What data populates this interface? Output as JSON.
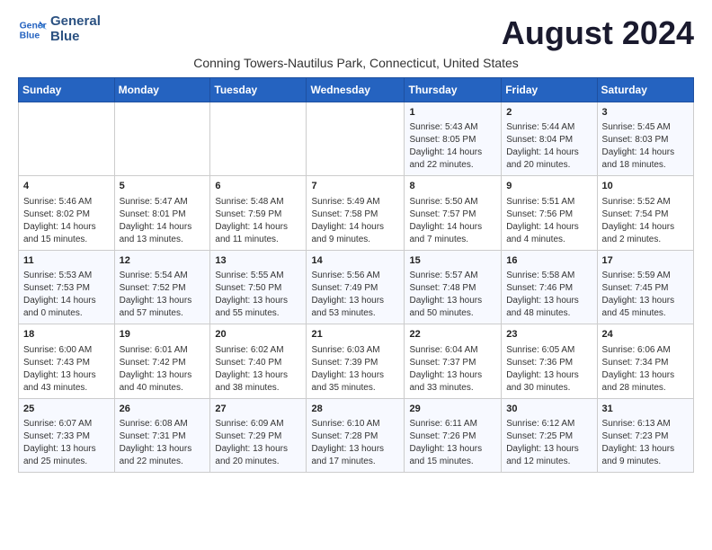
{
  "header": {
    "logo_line1": "General",
    "logo_line2": "Blue",
    "month_title": "August 2024",
    "subtitle": "Conning Towers-Nautilus Park, Connecticut, United States"
  },
  "weekdays": [
    "Sunday",
    "Monday",
    "Tuesday",
    "Wednesday",
    "Thursday",
    "Friday",
    "Saturday"
  ],
  "weeks": [
    [
      {
        "day": "",
        "info": ""
      },
      {
        "day": "",
        "info": ""
      },
      {
        "day": "",
        "info": ""
      },
      {
        "day": "",
        "info": ""
      },
      {
        "day": "1",
        "info": "Sunrise: 5:43 AM\nSunset: 8:05 PM\nDaylight: 14 hours and 22 minutes."
      },
      {
        "day": "2",
        "info": "Sunrise: 5:44 AM\nSunset: 8:04 PM\nDaylight: 14 hours and 20 minutes."
      },
      {
        "day": "3",
        "info": "Sunrise: 5:45 AM\nSunset: 8:03 PM\nDaylight: 14 hours and 18 minutes."
      }
    ],
    [
      {
        "day": "4",
        "info": "Sunrise: 5:46 AM\nSunset: 8:02 PM\nDaylight: 14 hours and 15 minutes."
      },
      {
        "day": "5",
        "info": "Sunrise: 5:47 AM\nSunset: 8:01 PM\nDaylight: 14 hours and 13 minutes."
      },
      {
        "day": "6",
        "info": "Sunrise: 5:48 AM\nSunset: 7:59 PM\nDaylight: 14 hours and 11 minutes."
      },
      {
        "day": "7",
        "info": "Sunrise: 5:49 AM\nSunset: 7:58 PM\nDaylight: 14 hours and 9 minutes."
      },
      {
        "day": "8",
        "info": "Sunrise: 5:50 AM\nSunset: 7:57 PM\nDaylight: 14 hours and 7 minutes."
      },
      {
        "day": "9",
        "info": "Sunrise: 5:51 AM\nSunset: 7:56 PM\nDaylight: 14 hours and 4 minutes."
      },
      {
        "day": "10",
        "info": "Sunrise: 5:52 AM\nSunset: 7:54 PM\nDaylight: 14 hours and 2 minutes."
      }
    ],
    [
      {
        "day": "11",
        "info": "Sunrise: 5:53 AM\nSunset: 7:53 PM\nDaylight: 14 hours and 0 minutes."
      },
      {
        "day": "12",
        "info": "Sunrise: 5:54 AM\nSunset: 7:52 PM\nDaylight: 13 hours and 57 minutes."
      },
      {
        "day": "13",
        "info": "Sunrise: 5:55 AM\nSunset: 7:50 PM\nDaylight: 13 hours and 55 minutes."
      },
      {
        "day": "14",
        "info": "Sunrise: 5:56 AM\nSunset: 7:49 PM\nDaylight: 13 hours and 53 minutes."
      },
      {
        "day": "15",
        "info": "Sunrise: 5:57 AM\nSunset: 7:48 PM\nDaylight: 13 hours and 50 minutes."
      },
      {
        "day": "16",
        "info": "Sunrise: 5:58 AM\nSunset: 7:46 PM\nDaylight: 13 hours and 48 minutes."
      },
      {
        "day": "17",
        "info": "Sunrise: 5:59 AM\nSunset: 7:45 PM\nDaylight: 13 hours and 45 minutes."
      }
    ],
    [
      {
        "day": "18",
        "info": "Sunrise: 6:00 AM\nSunset: 7:43 PM\nDaylight: 13 hours and 43 minutes."
      },
      {
        "day": "19",
        "info": "Sunrise: 6:01 AM\nSunset: 7:42 PM\nDaylight: 13 hours and 40 minutes."
      },
      {
        "day": "20",
        "info": "Sunrise: 6:02 AM\nSunset: 7:40 PM\nDaylight: 13 hours and 38 minutes."
      },
      {
        "day": "21",
        "info": "Sunrise: 6:03 AM\nSunset: 7:39 PM\nDaylight: 13 hours and 35 minutes."
      },
      {
        "day": "22",
        "info": "Sunrise: 6:04 AM\nSunset: 7:37 PM\nDaylight: 13 hours and 33 minutes."
      },
      {
        "day": "23",
        "info": "Sunrise: 6:05 AM\nSunset: 7:36 PM\nDaylight: 13 hours and 30 minutes."
      },
      {
        "day": "24",
        "info": "Sunrise: 6:06 AM\nSunset: 7:34 PM\nDaylight: 13 hours and 28 minutes."
      }
    ],
    [
      {
        "day": "25",
        "info": "Sunrise: 6:07 AM\nSunset: 7:33 PM\nDaylight: 13 hours and 25 minutes."
      },
      {
        "day": "26",
        "info": "Sunrise: 6:08 AM\nSunset: 7:31 PM\nDaylight: 13 hours and 22 minutes."
      },
      {
        "day": "27",
        "info": "Sunrise: 6:09 AM\nSunset: 7:29 PM\nDaylight: 13 hours and 20 minutes."
      },
      {
        "day": "28",
        "info": "Sunrise: 6:10 AM\nSunset: 7:28 PM\nDaylight: 13 hours and 17 minutes."
      },
      {
        "day": "29",
        "info": "Sunrise: 6:11 AM\nSunset: 7:26 PM\nDaylight: 13 hours and 15 minutes."
      },
      {
        "day": "30",
        "info": "Sunrise: 6:12 AM\nSunset: 7:25 PM\nDaylight: 13 hours and 12 minutes."
      },
      {
        "day": "31",
        "info": "Sunrise: 6:13 AM\nSunset: 7:23 PM\nDaylight: 13 hours and 9 minutes."
      }
    ]
  ]
}
